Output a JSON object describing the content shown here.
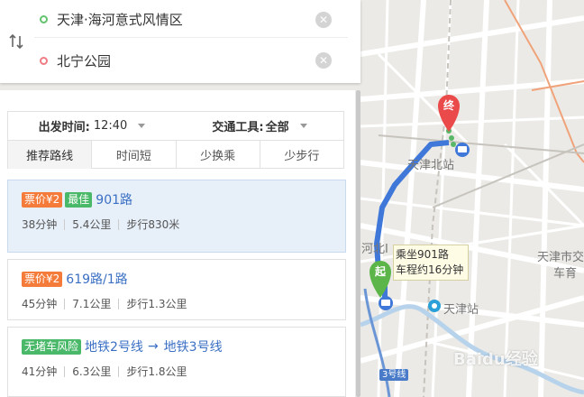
{
  "search": {
    "start": "天津·海河意式风情区",
    "end": "北宁公园"
  },
  "filters": {
    "depart_label": "出发时间:",
    "depart_value": "12:40",
    "transport_label": "交通工具:",
    "transport_value": "全部"
  },
  "tabs": [
    "推荐路线",
    "时间短",
    "少换乘",
    "少步行"
  ],
  "routes": [
    {
      "badges": [
        {
          "text": "票价¥2",
          "color": "#f47b39"
        },
        {
          "text": "最佳",
          "color": "#49b969"
        }
      ],
      "name": "901路",
      "duration": "38分钟",
      "distance": "5.4公里",
      "walk": "步行830米"
    },
    {
      "badges": [
        {
          "text": "票价¥2",
          "color": "#f47b39"
        }
      ],
      "name": "619路/1路",
      "duration": "45分钟",
      "distance": "7.1公里",
      "walk": "步行1.3公里"
    },
    {
      "badges": [
        {
          "text": "无堵车风险",
          "color": "#49b969"
        }
      ],
      "name_part1": "地铁2号线",
      "arrow": "→",
      "name_part2": "地铁3号线",
      "duration": "41分钟",
      "distance": "6.3公里",
      "walk": "步行1.8公里"
    }
  ],
  "map": {
    "end_marker": "终",
    "start_marker": "起",
    "tooltip_line1": "乘坐901路",
    "tooltip_line2": "车程约16分钟",
    "labels": {
      "tianjin_north": "天津北站",
      "tianjin_station": "天津站",
      "hebei": "河北Ⅰ",
      "tianjin_city": "天津市交",
      "chezhan": "车育"
    },
    "line_tag": "3号线",
    "watermark": "Baidu经验",
    "route_color": "#3f78d8"
  }
}
